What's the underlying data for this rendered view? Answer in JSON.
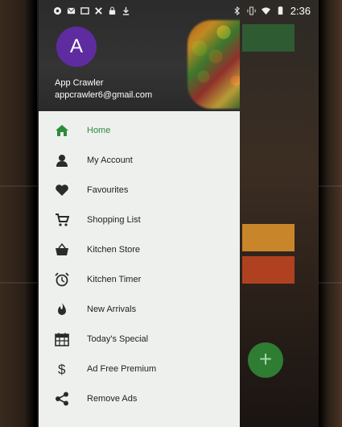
{
  "status_bar": {
    "time": "2:36",
    "left_icons": [
      "vpn-icon",
      "mail-icon",
      "cast-icon",
      "tools-icon",
      "lock-icon",
      "download-icon"
    ],
    "right_icons": [
      "bluetooth-icon",
      "vibrate-icon",
      "wifi-icon",
      "battery-icon"
    ]
  },
  "drawer": {
    "header": {
      "avatar_letter": "A",
      "name": "App Crawler",
      "email": "appcrawler6@gmail.com"
    },
    "items": [
      {
        "label": "Home",
        "icon": "home-icon",
        "active": true
      },
      {
        "label": "My Account",
        "icon": "person-icon",
        "active": false
      },
      {
        "label": "Favourites",
        "icon": "heart-icon",
        "active": false
      },
      {
        "label": "Shopping List",
        "icon": "cart-icon",
        "active": false
      },
      {
        "label": "Kitchen Store",
        "icon": "basket-icon",
        "active": false
      },
      {
        "label": "Kitchen Timer",
        "icon": "alarm-icon",
        "active": false
      },
      {
        "label": "New Arrivals",
        "icon": "flame-icon",
        "active": false
      },
      {
        "label": "Today's Special",
        "icon": "calendar-icon",
        "active": false
      },
      {
        "label": "Ad Free Premium",
        "icon": "dollar-icon",
        "active": false
      },
      {
        "label": "Remove Ads",
        "icon": "share-icon",
        "active": false
      }
    ]
  },
  "colors": {
    "active_green": "#2e8b3a",
    "avatar_purple": "#5e2ca0",
    "drawer_bg": "#eef0ee",
    "icon_color": "#2b2b2b"
  }
}
